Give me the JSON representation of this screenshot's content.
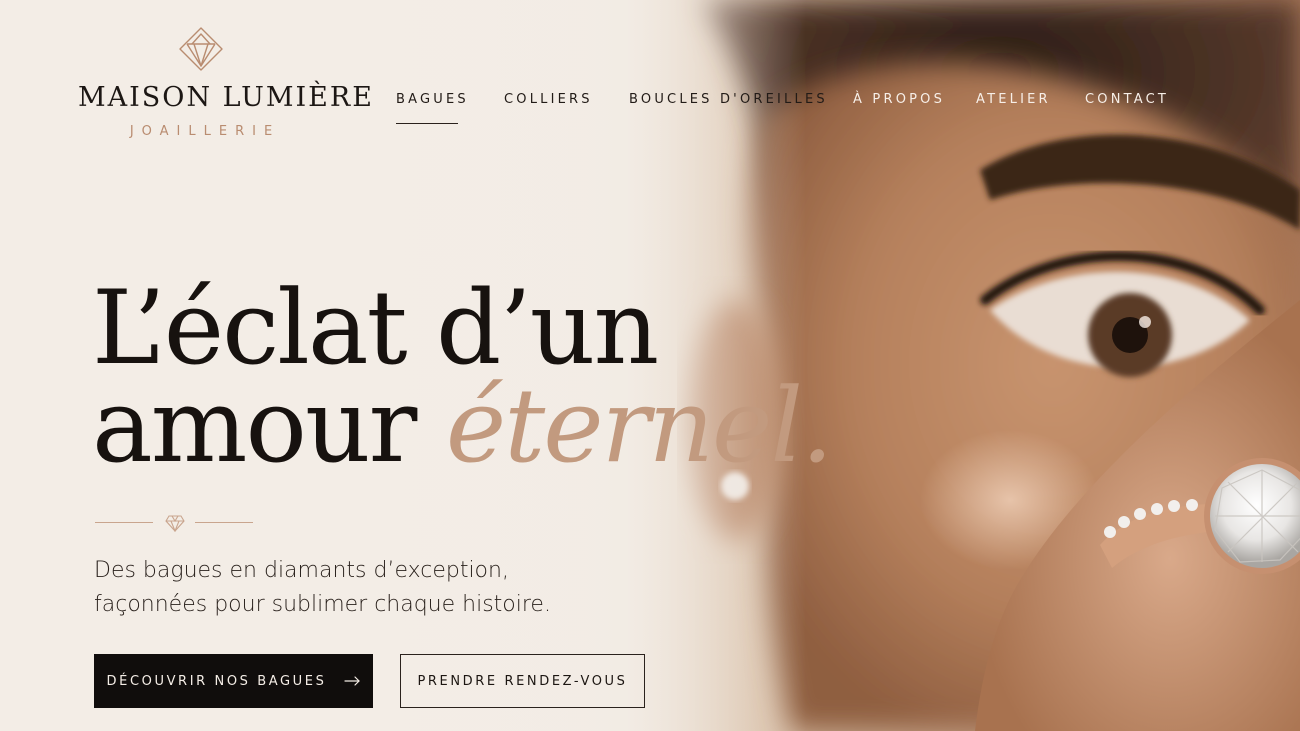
{
  "brand": {
    "name": "MAISON LUMIÈRE",
    "subtitle": "JOAILLERIE",
    "logo_icon": "diamond-outline-icon"
  },
  "nav": {
    "items": [
      {
        "label": "BAGUES",
        "active": true
      },
      {
        "label": "COLLIERS",
        "active": false
      },
      {
        "label": "BOUCLES D'OREILLES",
        "active": false
      },
      {
        "label": "À PROPOS",
        "active": false
      },
      {
        "label": "ATELIER",
        "active": false
      },
      {
        "label": "CONTACT",
        "active": false
      }
    ]
  },
  "hero": {
    "title_line1": "L’éclat d’un",
    "title_line2_plain": "amour",
    "title_line2_accent": "éternel.",
    "tagline_line1": "Des bagues en diamants d’exception,",
    "tagline_line2": "façonnées pour sublimer chaque histoire.",
    "divider_icon": "small-diamond-icon"
  },
  "cta": {
    "primary_label": "DÉCOUVRIR NOS BAGUES",
    "primary_icon": "arrow-right-icon",
    "secondary_label": "PRENDRE RENDEZ-VOUS"
  },
  "colors": {
    "accent": "#c29a7f",
    "text_dark": "#17120f",
    "button_dark": "#100d0c",
    "background": "#f3ede6"
  }
}
